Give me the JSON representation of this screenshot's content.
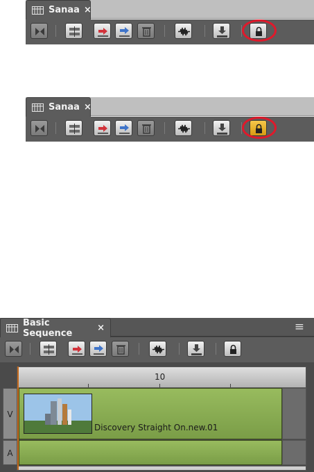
{
  "top_panel": {
    "tab_title": "Sanaa",
    "close_glyph": "×",
    "lock_state": "unlocked"
  },
  "middle_panel": {
    "tab_title": "Sanaa",
    "close_glyph": "×",
    "lock_state": "locked"
  },
  "bottom_panel": {
    "tab_title": "Basic Sequence",
    "close_glyph": "×",
    "menu_glyph": "≡",
    "ruler": {
      "marker_10": "10"
    },
    "tracks": {
      "video_label": "V",
      "audio_label": "A"
    },
    "clip": {
      "name": "Discovery Straight On.new.01"
    }
  },
  "toolbar_icons": [
    "toggle-source-record-icon",
    "splice-in-icon",
    "overwrite-icon",
    "lift-icon",
    "delete-icon",
    "audio-waveform-icon",
    "export-icon",
    "lock-icon"
  ],
  "colors": {
    "lock_active": "#e0a620",
    "highlight_ring": "#e0192b",
    "track_fill": "#8cab52",
    "playhead": "#c66a1c"
  }
}
